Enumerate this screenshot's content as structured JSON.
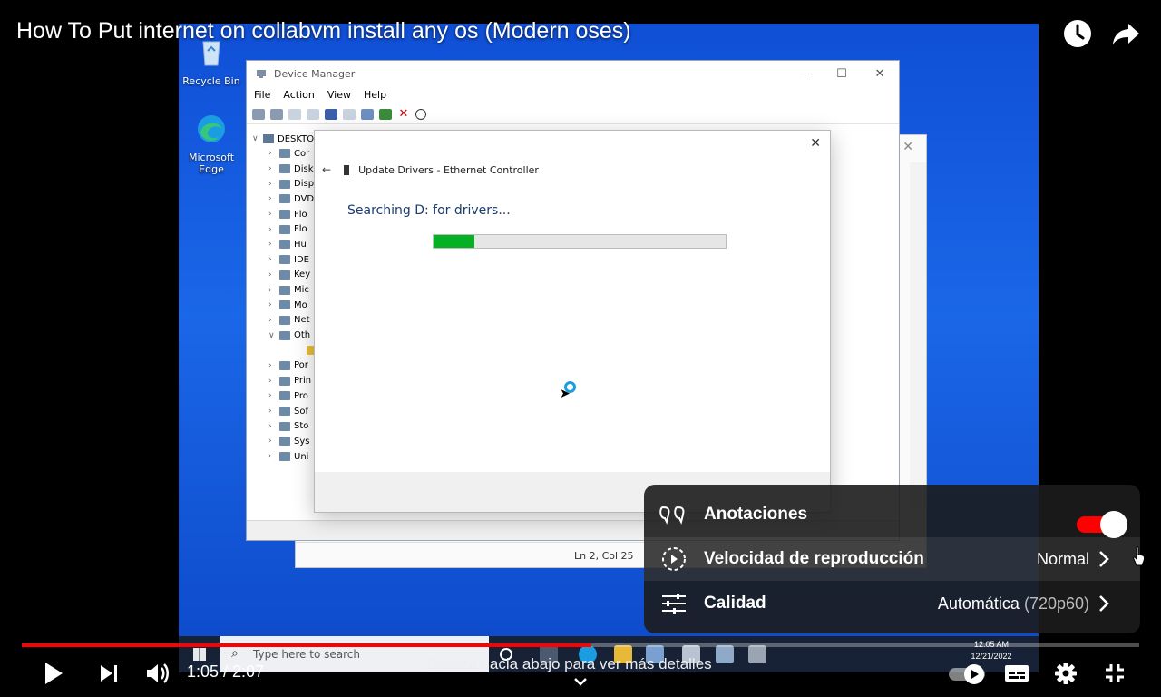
{
  "video": {
    "title": "How To Put internet on collabvm install any os (Modern oses)",
    "desktop": {
      "icons": [
        {
          "label": "Recycle Bin",
          "icon": "recycle-bin-icon"
        },
        {
          "label": "Microsoft Edge",
          "icon": "edge-icon"
        }
      ],
      "device_manager": {
        "title": "Device Manager",
        "menu": [
          "File",
          "Action",
          "View",
          "Help"
        ],
        "root": "DESKTO",
        "tree": [
          "Cor",
          "Disk",
          "Disp",
          "DVD",
          "Flo",
          "Flo",
          "Hu",
          "IDE",
          "Key",
          "Mic",
          "Mo",
          "Net",
          "Oth",
          "",
          "Por",
          "Prin",
          "Pro",
          "Sof",
          "Sto",
          "Sys",
          "Uni"
        ]
      },
      "back_window": {
        "status": "Ln 2, Col 25"
      },
      "update_dialog": {
        "header": "Update Drivers - Ethernet Controller",
        "message": "Searching D: for drivers...",
        "progress_fraction": 0.14
      },
      "taskbar": {
        "search_placeholder": "Type here to search",
        "time": "12:05 AM",
        "date": "12/21/2022"
      }
    }
  },
  "settings_menu": {
    "rows": [
      {
        "label": "Anotaciones",
        "icon": "annotations-icon",
        "toggle_on": true
      },
      {
        "label": "Velocidad de reproducción",
        "icon": "playback-speed-icon",
        "value": "Normal"
      },
      {
        "label": "Calidad",
        "icon": "quality-sliders-icon",
        "value": "Automática",
        "value_detail": "(720p60)"
      }
    ]
  },
  "player": {
    "time": "1:05 / 2:07",
    "played_fraction": 0.51,
    "hint": "Desliza hacia abajo para ver más detalles",
    "accent": "#ff0000"
  }
}
